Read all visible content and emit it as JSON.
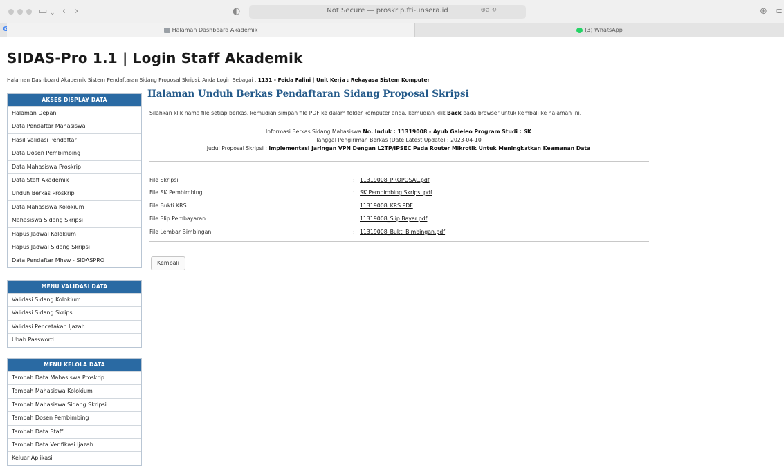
{
  "browser": {
    "address": "Not Secure — proskrip.fti-unsera.id",
    "address_right": "⊕a ↻",
    "tabs": [
      {
        "label": "Halaman Dashboard Akademik"
      },
      {
        "label": "(3) WhatsApp"
      }
    ],
    "google_letter": "G"
  },
  "header": {
    "title": "SIDAS-Pro 1.1 | Login Staff Akademik",
    "subline_prefix": "Halaman Dashboard Akademik Sistem Pendaftaran Sidang Proposal Skripsi. Anda Login Sebagai : ",
    "subline_user": "1131 - Feida Falini | Unit Kerja : Rekayasa Sistem Komputer"
  },
  "sidebar": {
    "sections": [
      {
        "heading": "AKSES DISPLAY DATA",
        "items": [
          "Halaman Depan",
          "Data Pendaftar Mahasiswa",
          "Hasil Validasi Pendaftar",
          "Data Dosen Pembimbing",
          "Data Mahasiswa Proskrip",
          "Data Staff Akademik",
          "Unduh Berkas Proskrip",
          "Data Mahasiswa Kolokium",
          "Mahasiswa Sidang Skripsi",
          "Hapus Jadwal Kolokium",
          "Hapus Jadwal Sidang Skripsi",
          "Data Pendaftar Mhsw - SIDASPRO"
        ]
      },
      {
        "heading": "MENU VALIDASI DATA",
        "items": [
          "Validasi Sidang Kolokium",
          "Validasi Sidang Skripsi",
          "Validasi Pencetakan Ijazah",
          "Ubah Password"
        ]
      },
      {
        "heading": "MENU KELOLA DATA",
        "items": [
          "Tambah Data Mahasiswa Proskrip",
          "Tambah Mahasiswa Kolokium",
          "Tambah Mahasiswa Sidang Skripsi",
          "Tambah Dosen Pembimbing",
          "Tambah Data Staff",
          "Tambah Data Verifikasi Ijazah",
          "Keluar Aplikasi"
        ]
      }
    ]
  },
  "main": {
    "title": "Halaman Unduh Berkas Pendaftaran Sidang Proposal Skripsi",
    "instruction_prefix": "Silahkan klik nama file setiap berkas, kemudian simpan file PDF ke dalam folder komputer anda, kemudian klik ",
    "instruction_bold": "Back",
    "instruction_suffix": " pada browser untuk kembali ke halaman ini.",
    "info_line1_prefix": "Informasi Berkas Sidang Mahasiswa ",
    "info_line1_bold": "No. Induk : 11319008 - Ayub Galeleo Program Studi : SK",
    "info_line2": "Tanggal Pengiriman Berkas (Date Latest Update) : 2023-04-10",
    "info_line3_prefix": "Judul Proposal Skripsi : ",
    "info_line3_bold": "Implementasi Jaringan VPN Dengan L2TP/IPSEC Pada Router Mikrotik Untuk Meningkatkan Keamanan Data",
    "files": [
      {
        "label": "File Skripsi",
        "colon": ":",
        "file": "11319008_PROPOSAL.pdf"
      },
      {
        "label": "File SK Pembimbing",
        "colon": ":",
        "file": "SK Pembimbing Skripsi.pdf"
      },
      {
        "label": "File Bukti KRS",
        "colon": ":",
        "file": "11319008_KRS.PDF"
      },
      {
        "label": "File Slip Pembayaran",
        "colon": ":",
        "file": "11319008_Slip Bayar.pdf"
      },
      {
        "label": "File Lembar Bimbingan",
        "colon": ":",
        "file": "11319008_Bukti Bimbingan.pdf"
      }
    ],
    "back_button": "Kembali"
  },
  "colors": {
    "sidebar_header": "#2a6aa3",
    "main_title": "#245a8a"
  }
}
